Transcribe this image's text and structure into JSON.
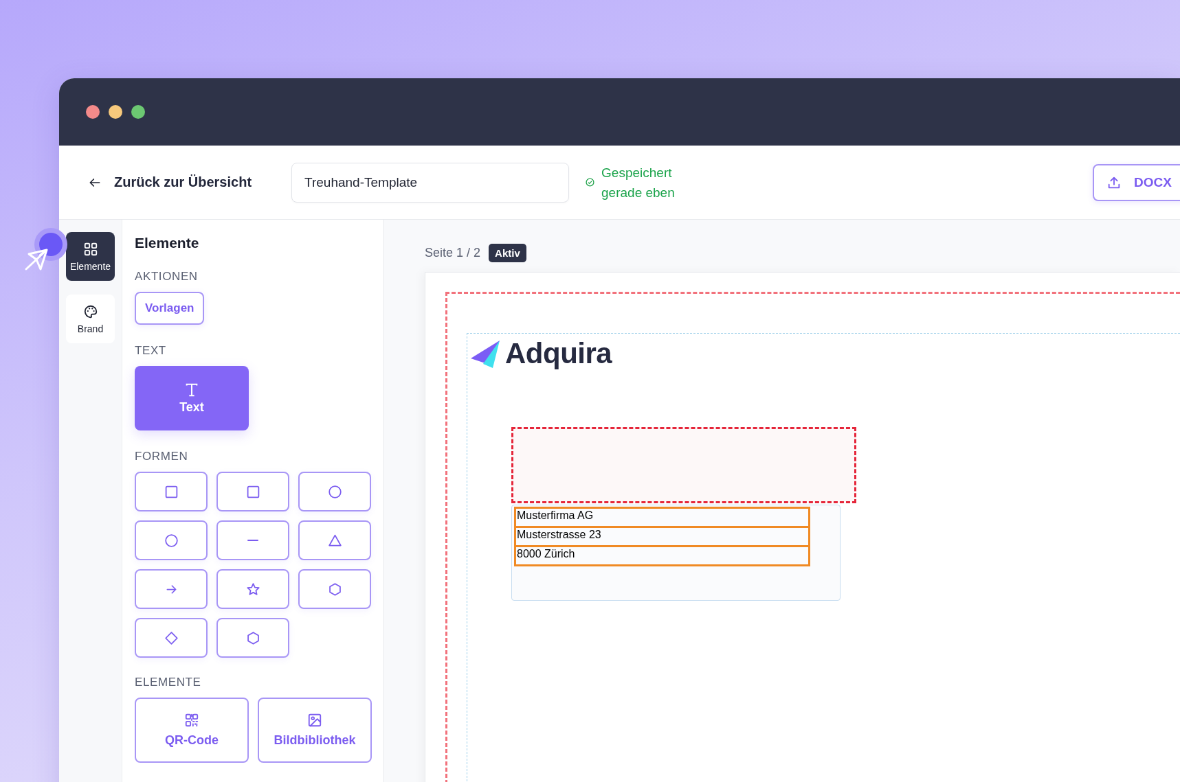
{
  "window": {
    "controls": [
      {
        "color": "#f48a8a"
      },
      {
        "color": "#f7c97c"
      },
      {
        "color": "#6cc872"
      }
    ]
  },
  "toolbar": {
    "back_label": "Zurück zur Übersicht",
    "title_field": {
      "value": "Treuhand-Template"
    },
    "save_status": "Gespeichert gerade eben",
    "export_button": {
      "label": "DOCX"
    }
  },
  "rail": [
    {
      "kind": "grid",
      "label": "Elemente",
      "selected": true
    },
    {
      "kind": "palette",
      "label": "Brand",
      "selected": false
    }
  ],
  "panel": {
    "title": "Elemente",
    "sections": [
      {
        "heading": "AKTIONEN",
        "kind": "actions",
        "items": [
          {
            "kind": "outline",
            "label": "Vorlagen"
          }
        ]
      },
      {
        "heading": "TEXT",
        "kind": "text",
        "items": [
          {
            "kind": "text",
            "label": "Text"
          }
        ]
      },
      {
        "heading": "FORMEN",
        "kind": "shapes",
        "items": [
          {
            "kind": "square"
          },
          {
            "kind": "square"
          },
          {
            "kind": "circle"
          },
          {
            "kind": "circle"
          },
          {
            "kind": "line"
          },
          {
            "kind": "triangle"
          },
          {
            "kind": "arrow"
          },
          {
            "kind": "star"
          },
          {
            "kind": "hexagon"
          },
          {
            "kind": "diamond"
          },
          {
            "kind": "hexagon"
          }
        ]
      },
      {
        "heading": "ELEMENTE",
        "kind": "elements",
        "items": [
          {
            "kind": "qr",
            "label": "QR-Code"
          },
          {
            "kind": "image",
            "label": "Bildbibliothek"
          }
        ]
      }
    ]
  },
  "canvas": {
    "page_indicator": "Seite 1 / 2",
    "status_badge": "Aktiv",
    "document": {
      "logo_text": "Adquira",
      "address_lines": [
        "Musterfirma AG",
        "Musterstrasse 23",
        "8000 Zürich"
      ]
    }
  }
}
